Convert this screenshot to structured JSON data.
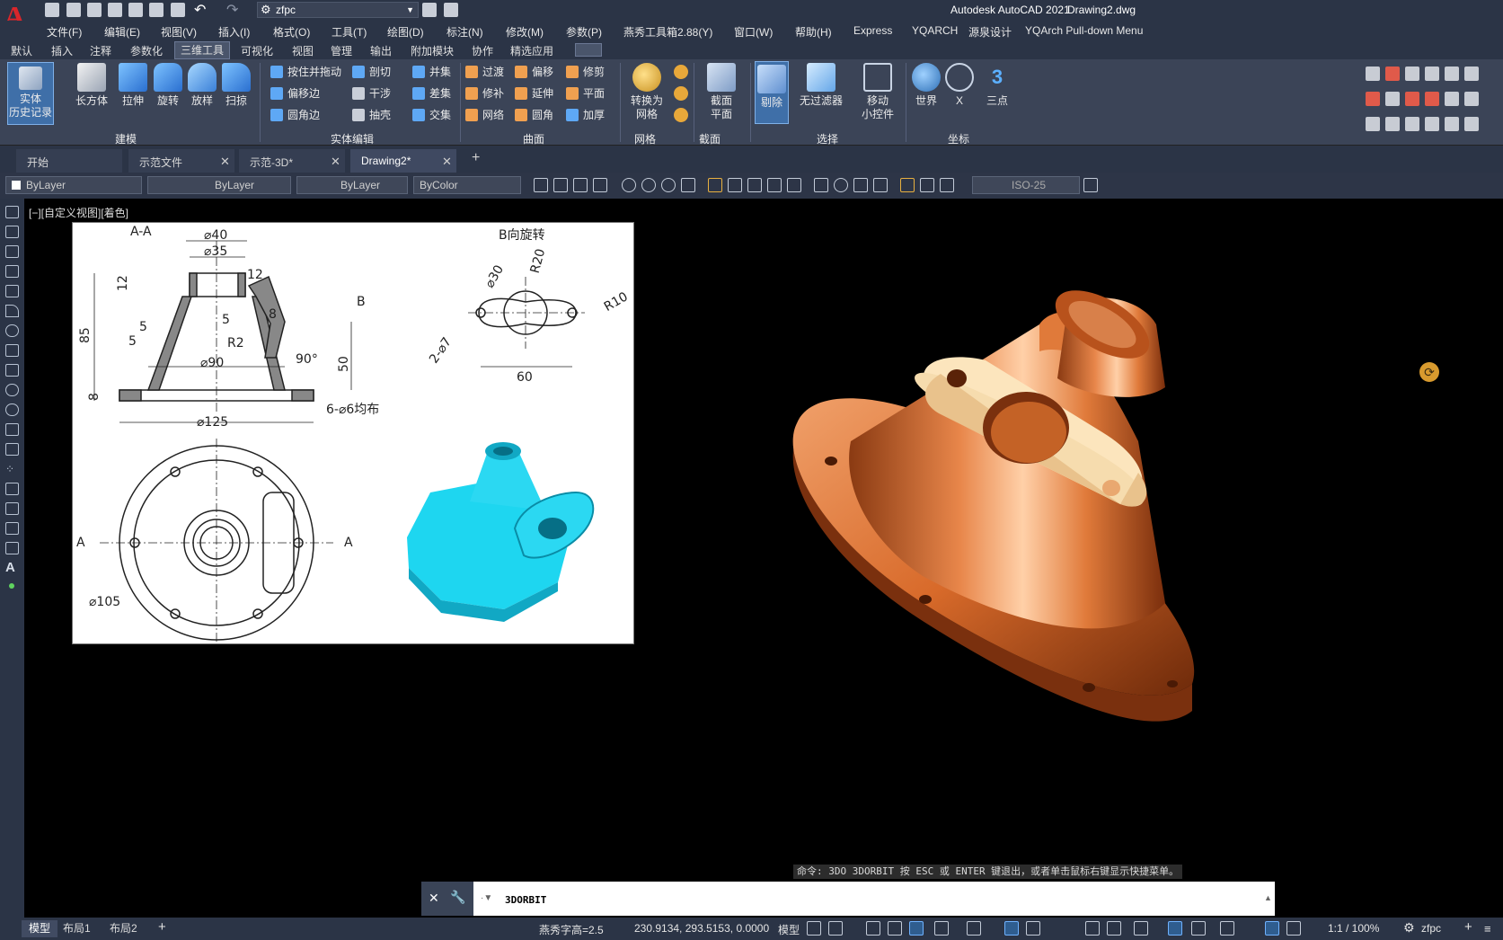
{
  "app": {
    "logo": "A",
    "title": "Autodesk AutoCAD 2021",
    "document": "Drawing2.dwg",
    "workspace": "zfpc"
  },
  "menus": [
    "文件(F)",
    "编辑(E)",
    "视图(V)",
    "插入(I)",
    "格式(O)",
    "工具(T)",
    "绘图(D)",
    "标注(N)",
    "修改(M)",
    "参数(P)",
    "燕秀工具箱2.88(Y)",
    "窗口(W)",
    "帮助(H)",
    "Express",
    "YQARCH",
    "源泉设计",
    "YQArch Pull-down Menu"
  ],
  "ribbon_tabs": [
    "默认",
    "插入",
    "注释",
    "参数化",
    "三维工具",
    "可视化",
    "视图",
    "管理",
    "输出",
    "附加模块",
    "协作",
    "精选应用"
  ],
  "ribbon_active_tab": "三维工具",
  "ribbon": {
    "history": "实体\n历史记录",
    "box": "长方体",
    "extrude": "拉伸",
    "revolve": "旋转",
    "loft": "放样",
    "sweep": "扫掠",
    "panel_model": "建模",
    "presspull": "按住并拖动",
    "offset_edge": "偏移边",
    "fillet_edge": "圆角边",
    "slice": "剖切",
    "interfere": "干涉",
    "shell": "抽壳",
    "union": "并集",
    "subtract": "差集",
    "intersect": "交集",
    "panel_solid_edit": "实体编辑",
    "blend": "过渡",
    "patch": "修补",
    "network": "网络",
    "offset": "偏移",
    "extend": "延伸",
    "fillet": "圆角",
    "trim": "修剪",
    "planar": "平面",
    "thicken": "加厚",
    "panel_surface": "曲面",
    "convert_mesh": "转换为\n网格",
    "panel_mesh": "网格",
    "section_plane": "截面\n平面",
    "panel_section": "截面",
    "culling": "剔除",
    "no_filter": "无过滤器",
    "move_gizmo": "移动\n小控件",
    "panel_selection": "选择",
    "world": "世界",
    "x_axis": "X",
    "three_point": "三点",
    "panel_coords": "坐标"
  },
  "doc_tabs": [
    {
      "label": "开始",
      "closable": false
    },
    {
      "label": "示范文件",
      "closable": true
    },
    {
      "label": "示范-3D*",
      "closable": true
    },
    {
      "label": "Drawing2*",
      "closable": true,
      "active": true
    }
  ],
  "properties": {
    "color": "ByLayer",
    "linetype": "ByLayer",
    "lineweight": "ByLayer",
    "plotstyle": "ByColor",
    "dimstyle": "ISO-25"
  },
  "viewport_label": "[−][自定义视图][着色]",
  "drawing": {
    "section_label": "A-A",
    "view_b_label": "B向旋转",
    "b_arrow": "B",
    "dims": [
      "⌀40",
      "⌀35",
      "12",
      "12",
      "5",
      "5",
      "8",
      "85",
      "5",
      "R2",
      "⌀90",
      "90°",
      "50",
      "⌀125",
      "6-⌀6均布",
      "8",
      "⌀30",
      "R20",
      "R10",
      "2-⌀7",
      "60",
      "⌀105",
      "A",
      "A"
    ]
  },
  "command": {
    "hint": "命令: 3DO 3DORBIT 按 ESC 或 ENTER 键退出，或者单击鼠标右键显示快捷菜单。",
    "current": "3DORBIT"
  },
  "layout_tabs": [
    {
      "label": "模型",
      "active": true
    },
    {
      "label": "布局1"
    },
    {
      "label": "布局2"
    }
  ],
  "status": {
    "text_height": "燕秀字高=2.5",
    "coords": "230.9134, 293.5153, 0.0000",
    "space": "模型",
    "scale": "1:1 / 100%",
    "workspace": "zfpc"
  },
  "colors": {
    "ui_dark": "#2b3446",
    "ribbon": "#3b4457",
    "model_orange": "#e07a3a",
    "model_cyan": "#1ed6f0",
    "flange_cream": "#f6dcae"
  }
}
